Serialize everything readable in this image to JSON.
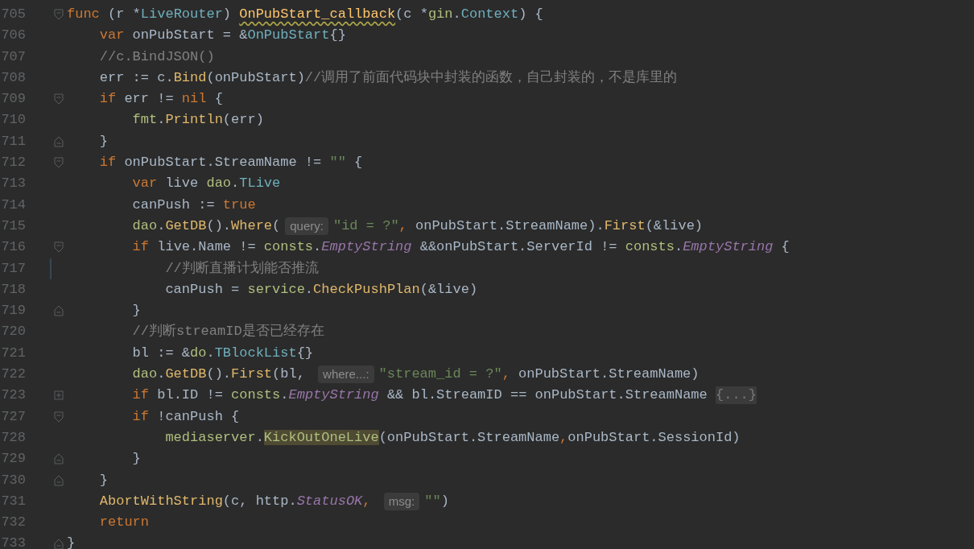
{
  "lines": [
    {
      "number": "705",
      "fold": {
        "kind": "open"
      },
      "changed": false,
      "segments": [
        {
          "kind": "code",
          "tokens": [
            {
              "text": "func",
              "kind": "kw"
            },
            {
              "text": " (r *",
              "kind": "plain"
            },
            {
              "text": "LiveRouter",
              "kind": "type"
            },
            {
              "text": ") ",
              "kind": "plain"
            },
            {
              "text": "OnPubStart_callback",
              "kind": "decl"
            },
            {
              "text": "(c *",
              "kind": "plain"
            },
            {
              "text": "gin",
              "kind": "pkg"
            },
            {
              "text": ".",
              "kind": "plain"
            },
            {
              "text": "Context",
              "kind": "type"
            },
            {
              "text": ") {",
              "kind": "plain"
            }
          ]
        }
      ]
    },
    {
      "number": "706",
      "changed": false,
      "segments": [
        {
          "kind": "code",
          "tokens": [
            {
              "text": "    var",
              "kind": "kw"
            },
            {
              "text": " onPubStart = &",
              "kind": "plain"
            },
            {
              "text": "OnPubStart",
              "kind": "type"
            },
            {
              "text": "{}",
              "kind": "plain"
            }
          ]
        }
      ]
    },
    {
      "number": "707",
      "changed": false,
      "segments": [
        {
          "kind": "code",
          "tokens": [
            {
              "text": "    //c.BindJSON()",
              "kind": "comment"
            }
          ]
        }
      ]
    },
    {
      "number": "708",
      "changed": false,
      "segments": [
        {
          "kind": "code",
          "tokens": [
            {
              "text": "    err := c.",
              "kind": "plain"
            },
            {
              "text": "Bind",
              "kind": "call"
            },
            {
              "text": "(onPubStart)",
              "kind": "plain"
            },
            {
              "text": "//调用了前面代码块中封装的函数，自己封装的，不是库里的",
              "kind": "comment"
            }
          ]
        }
      ]
    },
    {
      "number": "709",
      "fold": {
        "kind": "open"
      },
      "changed": false,
      "segments": [
        {
          "kind": "code",
          "tokens": [
            {
              "text": "    if",
              "kind": "kw"
            },
            {
              "text": " err != ",
              "kind": "plain"
            },
            {
              "text": "nil",
              "kind": "kw"
            },
            {
              "text": " {",
              "kind": "plain"
            }
          ]
        }
      ]
    },
    {
      "number": "710",
      "changed": false,
      "segments": [
        {
          "kind": "code",
          "tokens": [
            {
              "text": "        fmt",
              "kind": "pkg"
            },
            {
              "text": ".",
              "kind": "plain"
            },
            {
              "text": "Println",
              "kind": "call"
            },
            {
              "text": "(err)",
              "kind": "plain"
            }
          ]
        }
      ]
    },
    {
      "number": "711",
      "fold": {
        "kind": "close"
      },
      "changed": false,
      "segments": [
        {
          "kind": "code",
          "tokens": [
            {
              "text": "    }",
              "kind": "plain"
            }
          ]
        }
      ]
    },
    {
      "number": "712",
      "fold": {
        "kind": "open"
      },
      "changed": false,
      "segments": [
        {
          "kind": "code",
          "tokens": [
            {
              "text": "    if",
              "kind": "kw"
            },
            {
              "text": " onPubStart.StreamName != ",
              "kind": "plain"
            },
            {
              "text": "\"\"",
              "kind": "str"
            },
            {
              "text": " {",
              "kind": "plain"
            }
          ]
        }
      ]
    },
    {
      "number": "713",
      "changed": false,
      "segments": [
        {
          "kind": "code",
          "tokens": [
            {
              "text": "        var",
              "kind": "kw"
            },
            {
              "text": " live ",
              "kind": "plain"
            },
            {
              "text": "dao",
              "kind": "pkg"
            },
            {
              "text": ".",
              "kind": "plain"
            },
            {
              "text": "TLive",
              "kind": "type"
            }
          ]
        }
      ]
    },
    {
      "number": "714",
      "changed": false,
      "segments": [
        {
          "kind": "code",
          "tokens": [
            {
              "text": "        canPush := ",
              "kind": "plain"
            },
            {
              "text": "true",
              "kind": "kw"
            }
          ]
        }
      ]
    },
    {
      "number": "715",
      "changed": false,
      "segments": [
        {
          "kind": "code",
          "tokens": [
            {
              "text": "        dao",
              "kind": "pkg"
            },
            {
              "text": ".",
              "kind": "plain"
            },
            {
              "text": "GetDB",
              "kind": "call"
            },
            {
              "text": "().",
              "kind": "plain"
            },
            {
              "text": "Where",
              "kind": "call"
            },
            {
              "text": "(",
              "kind": "plain"
            }
          ]
        },
        {
          "kind": "hint",
          "text": "query:"
        },
        {
          "kind": "code",
          "tokens": [
            {
              "text": "\"id = ?\"",
              "kind": "str"
            },
            {
              "text": ", ",
              "kind": "kw"
            },
            {
              "text": "onPubStart.StreamName).",
              "kind": "plain"
            },
            {
              "text": "First",
              "kind": "call"
            },
            {
              "text": "(&live)",
              "kind": "plain"
            }
          ]
        }
      ]
    },
    {
      "number": "716",
      "fold": {
        "kind": "open"
      },
      "changed": false,
      "segments": [
        {
          "kind": "code",
          "tokens": [
            {
              "text": "        if",
              "kind": "kw"
            },
            {
              "text": " live.Name != ",
              "kind": "plain"
            },
            {
              "text": "consts",
              "kind": "pkg"
            },
            {
              "text": ".",
              "kind": "plain"
            },
            {
              "text": "EmptyString",
              "kind": "const"
            },
            {
              "text": " &&onPubStart.ServerId != ",
              "kind": "plain"
            },
            {
              "text": "consts",
              "kind": "pkg"
            },
            {
              "text": ".",
              "kind": "plain"
            },
            {
              "text": "EmptyString",
              "kind": "const"
            },
            {
              "text": " {",
              "kind": "plain"
            }
          ]
        }
      ]
    },
    {
      "number": "717",
      "changed": true,
      "segments": [
        {
          "kind": "code",
          "tokens": [
            {
              "text": "            //判断直播计划能否推流",
              "kind": "comment"
            }
          ]
        }
      ]
    },
    {
      "number": "718",
      "changed": false,
      "segments": [
        {
          "kind": "code",
          "tokens": [
            {
              "text": "            canPush = ",
              "kind": "plain"
            },
            {
              "text": "service",
              "kind": "pkg"
            },
            {
              "text": ".",
              "kind": "plain"
            },
            {
              "text": "CheckPushPlan",
              "kind": "call"
            },
            {
              "text": "(&live)",
              "kind": "plain"
            }
          ]
        }
      ]
    },
    {
      "number": "719",
      "fold": {
        "kind": "close"
      },
      "changed": false,
      "segments": [
        {
          "kind": "code",
          "tokens": [
            {
              "text": "        }",
              "kind": "plain"
            }
          ]
        }
      ]
    },
    {
      "number": "720",
      "changed": false,
      "segments": [
        {
          "kind": "code",
          "tokens": [
            {
              "text": "        //判断streamID是否已经存在",
              "kind": "comment"
            }
          ]
        }
      ]
    },
    {
      "number": "721",
      "changed": false,
      "segments": [
        {
          "kind": "code",
          "tokens": [
            {
              "text": "        bl := &",
              "kind": "plain"
            },
            {
              "text": "do",
              "kind": "pkg"
            },
            {
              "text": ".",
              "kind": "plain"
            },
            {
              "text": "TBlockList",
              "kind": "type"
            },
            {
              "text": "{}",
              "kind": "plain"
            }
          ]
        }
      ]
    },
    {
      "number": "722",
      "changed": false,
      "segments": [
        {
          "kind": "code",
          "tokens": [
            {
              "text": "        dao",
              "kind": "pkg"
            },
            {
              "text": ".",
              "kind": "plain"
            },
            {
              "text": "GetDB",
              "kind": "call"
            },
            {
              "text": "().",
              "kind": "plain"
            },
            {
              "text": "First",
              "kind": "call"
            },
            {
              "text": "(bl, ",
              "kind": "plain"
            }
          ]
        },
        {
          "kind": "hint",
          "text": "where...:"
        },
        {
          "kind": "code",
          "tokens": [
            {
              "text": "\"stream_id = ?\"",
              "kind": "str"
            },
            {
              "text": ", ",
              "kind": "kw"
            },
            {
              "text": "onPubStart.StreamName)",
              "kind": "plain"
            }
          ]
        }
      ]
    },
    {
      "number": "723",
      "fold": {
        "kind": "plus"
      },
      "changed": false,
      "segments": [
        {
          "kind": "code",
          "tokens": [
            {
              "text": "        if",
              "kind": "kw"
            },
            {
              "text": " bl.ID != ",
              "kind": "plain"
            },
            {
              "text": "consts",
              "kind": "pkg"
            },
            {
              "text": ".",
              "kind": "plain"
            },
            {
              "text": "EmptyString",
              "kind": "const"
            },
            {
              "text": " && bl.StreamID == onPubStart.StreamName ",
              "kind": "plain"
            }
          ]
        },
        {
          "kind": "folded",
          "text": "{...}"
        }
      ]
    },
    {
      "number": "727",
      "fold": {
        "kind": "open"
      },
      "changed": false,
      "segments": [
        {
          "kind": "code",
          "tokens": [
            {
              "text": "        if",
              "kind": "kw"
            },
            {
              "text": " !canPush {",
              "kind": "plain"
            }
          ]
        }
      ]
    },
    {
      "number": "728",
      "changed": false,
      "segments": [
        {
          "kind": "code",
          "tokens": [
            {
              "text": "            mediaserver",
              "kind": "pkg"
            },
            {
              "text": ".",
              "kind": "plain"
            },
            {
              "text": "KickOutOneLive",
              "kind": "usage"
            },
            {
              "text": "(onPubStart.StreamName",
              "kind": "plain"
            },
            {
              "text": ",",
              "kind": "kw"
            },
            {
              "text": "onPubStart.SessionId)",
              "kind": "plain"
            }
          ]
        }
      ]
    },
    {
      "number": "729",
      "fold": {
        "kind": "close"
      },
      "changed": false,
      "segments": [
        {
          "kind": "code",
          "tokens": [
            {
              "text": "        }",
              "kind": "plain"
            }
          ]
        }
      ]
    },
    {
      "number": "730",
      "fold": {
        "kind": "close"
      },
      "changed": false,
      "segments": [
        {
          "kind": "code",
          "tokens": [
            {
              "text": "    }",
              "kind": "plain"
            }
          ]
        }
      ]
    },
    {
      "number": "731",
      "changed": false,
      "segments": [
        {
          "kind": "code",
          "tokens": [
            {
              "text": "    AbortWithString",
              "kind": "call"
            },
            {
              "text": "(c, http.",
              "kind": "plain"
            },
            {
              "text": "StatusOK",
              "kind": "const"
            },
            {
              "text": ", ",
              "kind": "kw"
            }
          ]
        },
        {
          "kind": "hint",
          "text": "msg:"
        },
        {
          "kind": "code",
          "tokens": [
            {
              "text": "\"\"",
              "kind": "str"
            },
            {
              "text": ")",
              "kind": "plain"
            }
          ]
        }
      ]
    },
    {
      "number": "732",
      "changed": false,
      "segments": [
        {
          "kind": "code",
          "tokens": [
            {
              "text": "    return",
              "kind": "kw"
            }
          ]
        }
      ]
    },
    {
      "number": "733",
      "fold": {
        "kind": "close"
      },
      "changed": false,
      "segments": [
        {
          "kind": "code",
          "tokens": [
            {
              "text": "}",
              "kind": "plain"
            }
          ]
        }
      ]
    }
  ]
}
